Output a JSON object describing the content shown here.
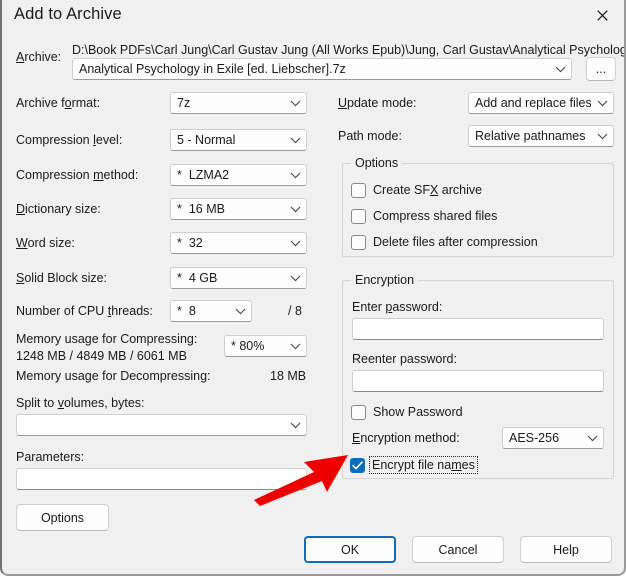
{
  "window": {
    "title": "Add to Archive",
    "close_icon": "close-icon"
  },
  "archive": {
    "label": "Archive:",
    "label_accesskey": "A",
    "path_text": "D:\\Book PDFs\\Carl Jung\\Carl Gustav Jung (All Works Epub)\\Jung, Carl Gustav\\Analytical Psychology in Exile [ed.",
    "name_value": "Analytical Psychology in Exile [ed. Liebscher].7z",
    "browse_label": "..."
  },
  "left_column": {
    "archive_format": {
      "label": "Archive format:",
      "value": "7z"
    },
    "compression_level": {
      "label": "Compression level:",
      "value": "5 - Normal"
    },
    "compression_method": {
      "label": "Compression method:",
      "star": "*",
      "value": "LZMA2"
    },
    "dictionary_size": {
      "label": "Dictionary size:",
      "star": "*",
      "value": "16 MB"
    },
    "word_size": {
      "label": "Word size:",
      "star": "*",
      "value": "32"
    },
    "solid_block_size": {
      "label": "Solid Block size:",
      "star": "*",
      "value": "4 GB"
    },
    "cpu_threads": {
      "label": "Number of CPU threads:",
      "star": "*",
      "value": "8",
      "total": "/ 8"
    },
    "mem_compress": {
      "label": "Memory usage for Compressing:",
      "values": "1248 MB / 4849 MB / 6061 MB",
      "star": "*",
      "percent": "80%"
    },
    "mem_decompress": {
      "label": "Memory usage for Decompressing:",
      "value": "18 MB"
    },
    "split_volumes": {
      "label": "Split to volumes, bytes:",
      "value": ""
    },
    "parameters": {
      "label": "Parameters:",
      "value": ""
    },
    "options_button": "Options"
  },
  "right_column": {
    "update_mode": {
      "label": "Update mode:",
      "value": "Add and replace files"
    },
    "path_mode": {
      "label": "Path mode:",
      "value": "Relative pathnames"
    },
    "options_group": {
      "title": "Options",
      "items": [
        {
          "label": "Create SFX archive",
          "checked": false
        },
        {
          "label": "Compress shared files",
          "checked": false
        },
        {
          "label": "Delete files after compression",
          "checked": false
        }
      ]
    },
    "encryption_group": {
      "title": "Encryption",
      "enter_password_label": "Enter password:",
      "enter_password_value": "",
      "reenter_password_label": "Reenter password:",
      "reenter_password_value": "",
      "show_password": {
        "label": "Show Password",
        "checked": false
      },
      "encryption_method": {
        "label": "Encryption method:",
        "value": "AES-256"
      },
      "encrypt_file_names": {
        "label": "Encrypt file names",
        "checked": true,
        "focused": true
      }
    }
  },
  "footer": {
    "ok": "OK",
    "cancel": "Cancel",
    "help": "Help"
  },
  "annotation": {
    "arrow_color": "#ee0000",
    "arrow_name": "red-arrow-annotation"
  },
  "colors": {
    "accent": "#0f6cbd",
    "dialog_bg": "#f0f0f0",
    "text": "#1a1a1a"
  }
}
